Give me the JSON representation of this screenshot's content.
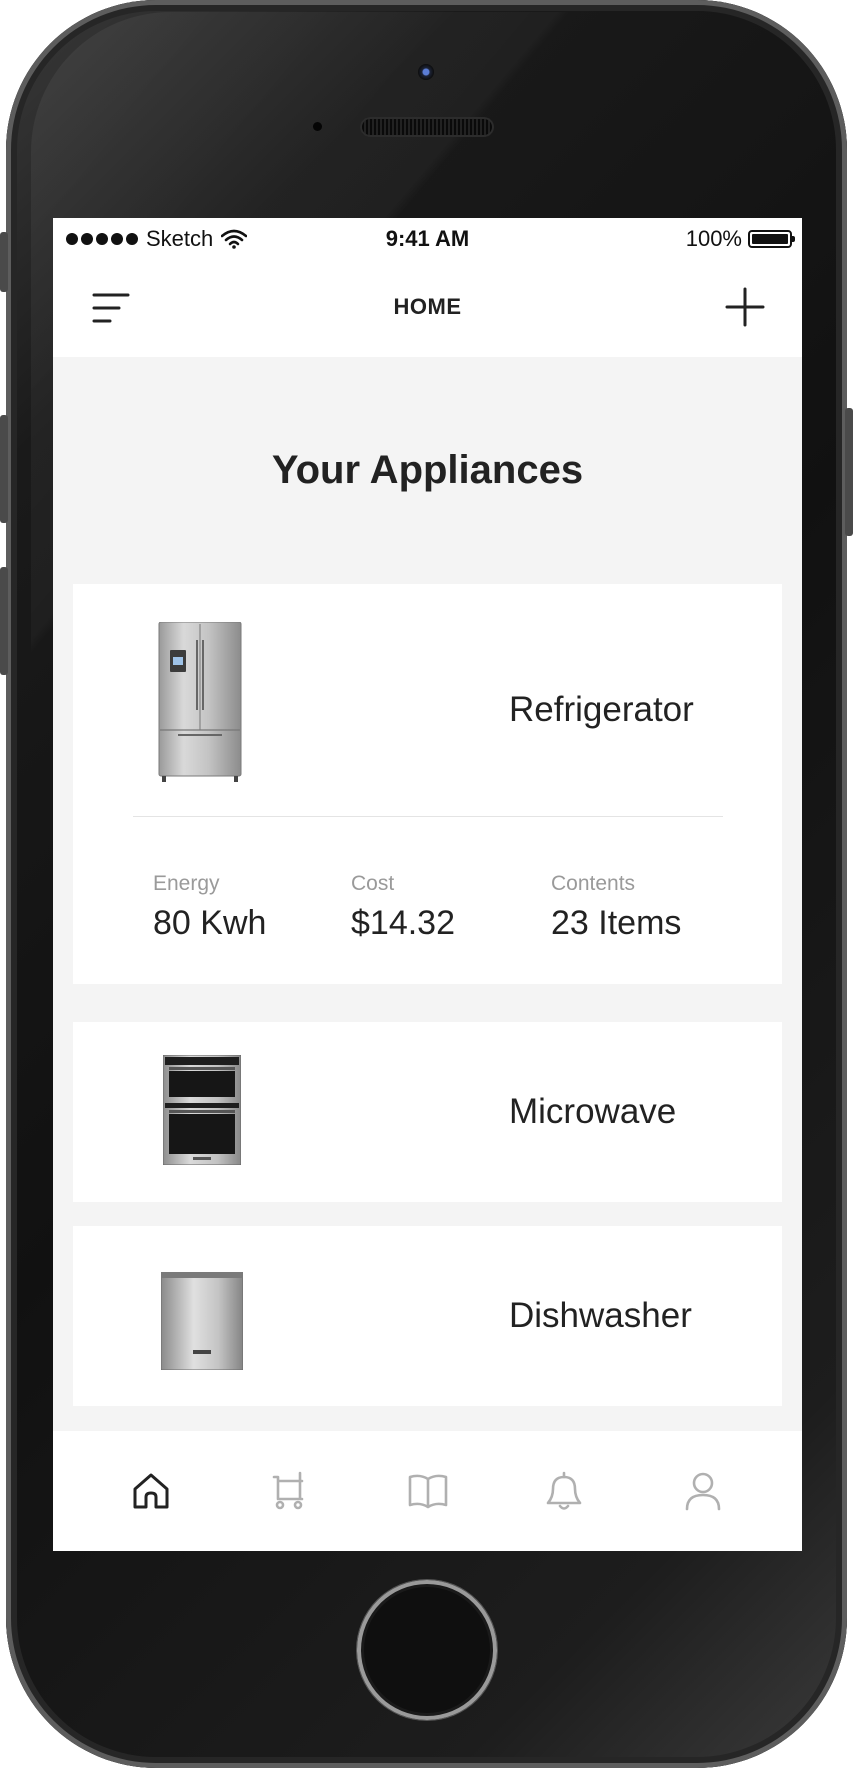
{
  "status_bar": {
    "carrier": "Sketch",
    "time": "9:41 AM",
    "battery": "100%"
  },
  "nav": {
    "title": "HOME"
  },
  "page": {
    "title": "Your Appliances"
  },
  "appliances": [
    {
      "name": "Refrigerator",
      "icon": "refrigerator-image",
      "stats": [
        {
          "label": "Energy",
          "value": "80 Kwh"
        },
        {
          "label": "Cost",
          "value": "$14.32"
        },
        {
          "label": "Contents",
          "value": "23 Items"
        }
      ]
    },
    {
      "name": "Microwave",
      "icon": "microwave-oven-image"
    },
    {
      "name": "Dishwasher",
      "icon": "dishwasher-image"
    }
  ],
  "tabs": [
    {
      "icon": "home-icon",
      "active": true
    },
    {
      "icon": "cart-icon",
      "active": false
    },
    {
      "icon": "book-icon",
      "active": false
    },
    {
      "icon": "bell-icon",
      "active": false
    },
    {
      "icon": "user-icon",
      "active": false
    }
  ],
  "colors": {
    "text_primary": "#222222",
    "text_secondary": "#9a9a9a",
    "tab_active": "#222222",
    "tab_inactive": "#b0b0b0",
    "background": "#f4f4f4"
  }
}
